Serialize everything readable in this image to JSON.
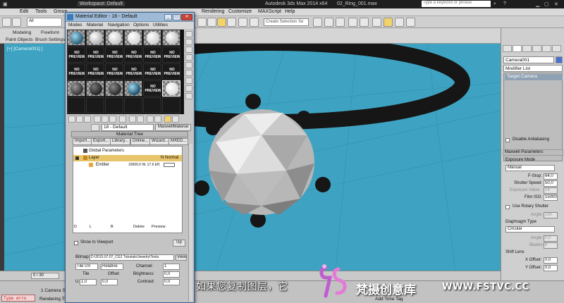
{
  "app": {
    "title": "Autodesk 3ds Max  2014 x64",
    "file": "02_Ring_001.max",
    "workspace": "Workspace: Default",
    "search_placeholder": "Type a keyword or phrase",
    "menu": [
      "Edit",
      "Tools",
      "Group",
      "Rendering",
      "Customize",
      "MAXScript",
      "Help"
    ],
    "selection_filter": "All",
    "named_selection": "Create Selection Se",
    "ribbon_tabs": [
      "Modeling",
      "Freeform"
    ],
    "ribbon_items": [
      "Paint Objects",
      "Brush Settings"
    ]
  },
  "viewport": {
    "label": "[+] [Camera001] [",
    "bg_color": "#3ea3c2"
  },
  "material_editor": {
    "title": "Material Editor - 18 - Default",
    "menu": [
      "Modes",
      "Material",
      "Navigation",
      "Options",
      "Utilities"
    ],
    "no_preview_text": "NO PREVIEW",
    "material_name": "18 - Default",
    "material_type": "MaxwellMaterial",
    "rollout_title": "Material Tree",
    "tree_tabs": [
      "Import...",
      "Export...",
      "Library...",
      "Online...",
      "Wizard...",
      "MXED..."
    ],
    "tree": {
      "global": "Global Parameters",
      "layer": "Layer",
      "layer_mode": "N Normal",
      "emitter": "Emitter",
      "emitter_value": "10000.0 W, 17.6 Eff."
    },
    "tree_footer": [
      "D",
      "L",
      "B",
      "Delete",
      "Preview"
    ],
    "show_in_viewport": "Show In Viewport",
    "up_button": "Up",
    "bitmap_label": "Bitmap:",
    "bitmap_path": "D:\\2015.07.07_CG2 Tutorials\\Jewelry\\Textu",
    "view_button": "View",
    "tile_mode": "Tile UV",
    "relative": "Relative",
    "tile_label": "Tile",
    "offset_label": "Offset",
    "tile_u": "1,0",
    "offset_u": "0,0",
    "u_label": "U:",
    "channel_label": "Channel:",
    "channel_value": "1",
    "brightness_label": "Brightness:",
    "brightness_value": "0,0",
    "contrast_label": "Contrast:",
    "contrast_value": "0,0"
  },
  "command_panel": {
    "object_name": "Camera001",
    "modifier_list": "Modifier List",
    "stack_item": "Target Camera",
    "disable_aa": "Disable Antialiasing",
    "maxwell_params": "Maxwell Parameters",
    "exposure_mode_label": "Exposure Mode",
    "exposure_mode": "Manual",
    "fstop_label": "F-Stop:",
    "fstop": "64,0",
    "shutter_label": "Shutter Speed:",
    "shutter": "50,0",
    "exposure_label": "Exposure Value:",
    "exposure": "14",
    "iso_label": "Film ISO:",
    "iso": "15000",
    "rotary_label": "Use Rotary Shutter",
    "angle_label": "Angle:",
    "angle": "180",
    "diaphragm_label": "Diaphragm Type",
    "diaphragm": "Circular",
    "angle2_label": "Angle:",
    "angle2": "0,0",
    "blades_label": "Blades:",
    "blades": "6",
    "shift_label": "Shift Lens",
    "xoff_label": "X Offset:",
    "xoff": "0,0",
    "yoff_label": "Y Offset:",
    "yoff": "0,0"
  },
  "timeline": {
    "slider": "0 / 30"
  },
  "status": {
    "script_error": "Type erro",
    "selection": "1 Camera Selected",
    "render_time": "Rendering Time  0:00:00",
    "add_time_tag": "Add Time Tag"
  },
  "subtitle": "如果您复制图层，它",
  "watermark": {
    "name": "梵摄创意库",
    "url": "WWW.FSTVC.CC"
  },
  "colors": {
    "viewport": "#3ea3c2",
    "ring": "#161616",
    "selected_row": "#e8c56b",
    "watermark_logo": "#c05bd0"
  }
}
